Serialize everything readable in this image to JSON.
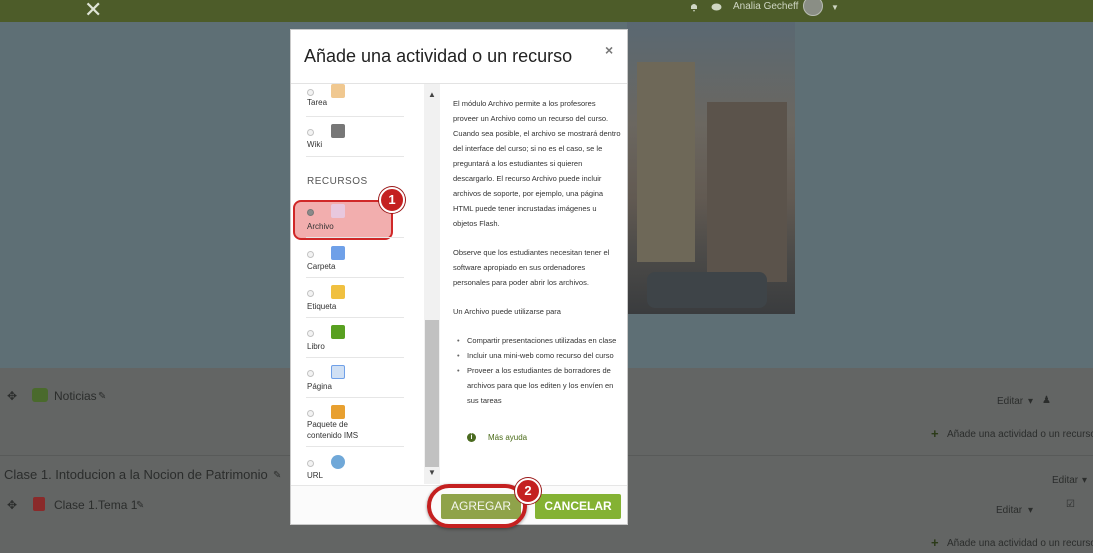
{
  "topbar": {
    "user_name": "Analia Gecheff"
  },
  "background": {
    "news": {
      "label": "Noticias",
      "edit_label": "Editar",
      "add_label": "Añade una actividad o un recurso"
    },
    "section": {
      "title": "Clase 1. Intoducion a la Nocion de Patrimonio",
      "edit_label": "Editar",
      "item": {
        "label": "Clase 1.Tema 1",
        "edit_label": "Editar"
      },
      "add_label": "Añade una actividad o un recurso"
    }
  },
  "modal": {
    "title": "Añade una actividad o un recurso",
    "close": "×",
    "section_header": "RECURSOS",
    "items_top": [
      {
        "label": "Tarea"
      },
      {
        "label": "Wiki"
      }
    ],
    "items": [
      {
        "label": "Archivo",
        "selected": true
      },
      {
        "label": "Carpeta"
      },
      {
        "label": "Etiqueta"
      },
      {
        "label": "Libro"
      },
      {
        "label": "Página"
      },
      {
        "label": "Paquete de contenido IMS"
      },
      {
        "label": "URL"
      }
    ],
    "description": {
      "p1": "El módulo Archivo permite a los profesores proveer un Archivo como un recurso del curso. Cuando sea posible, el archivo se mostrará dentro del interface del curso; si no es el caso, se le preguntará a los estudiantes si quieren descargarlo. El recurso Archivo puede incluir archivos de soporte, por ejemplo, una página HTML puede tener incrustadas imágenes u objetos Flash.",
      "p2": "Observe que los estudiantes necesitan tener el software apropiado en sus ordenadores personales para poder abrir los archivos.",
      "p3": "Un Archivo puede utilizarse para",
      "bullets": [
        "Compartir presentaciones utilizadas en clase",
        "Incluir una mini-web como recurso del curso",
        "Proveer a los estudiantes de borradores de archivos para que los editen y los envíen en sus tareas"
      ],
      "help_link": "Más ayuda"
    },
    "buttons": {
      "add": "AGREGAR",
      "cancel": "CANCELAR"
    }
  },
  "annotations": {
    "badge1": "1",
    "badge2": "2"
  },
  "colors": {
    "topbar": "#4d5c29",
    "accent_green": "#84b233",
    "highlight_red": "#c42020"
  }
}
